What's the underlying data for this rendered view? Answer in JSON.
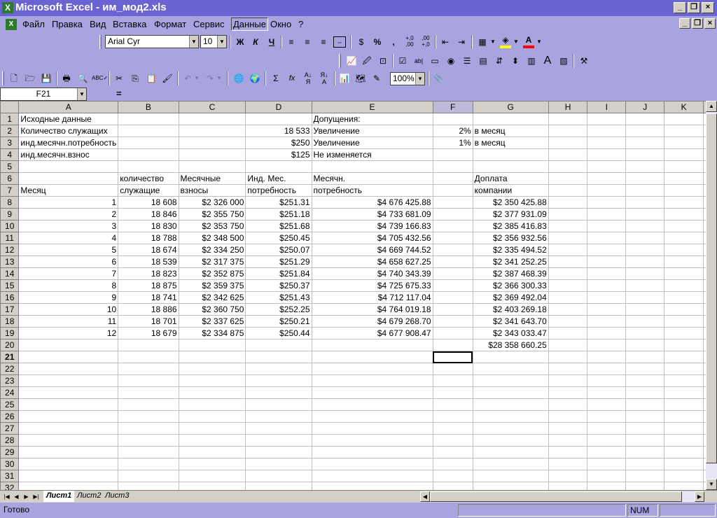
{
  "window": {
    "title": "Microsoft Excel - им_мод2.xls",
    "logo": "X"
  },
  "menu": [
    "Файл",
    "Правка",
    "Вид",
    "Вставка",
    "Формат",
    "Сервис",
    "Данные",
    "Окно",
    "?"
  ],
  "menu_active": "Данные",
  "format_toolbar": {
    "font_name": "Arial Cyr",
    "font_size": "10",
    "bold": "Ж",
    "italic": "К",
    "underline": "Ч",
    "percent": "%",
    "comma": ",",
    "inc_decimal": "+,0\n,00",
    "dec_decimal": ",00\n+,0"
  },
  "standard_toolbar": {
    "zoom": "100%",
    "sum": "Σ",
    "fx": "fx"
  },
  "formula_bar": {
    "name_box": "F21",
    "equals": "=",
    "content": ""
  },
  "columns": [
    "A",
    "B",
    "C",
    "D",
    "E",
    "F",
    "G",
    "H",
    "I",
    "J",
    "K"
  ],
  "selected_column": "F",
  "selected_row": "21",
  "rows": [
    {
      "n": "1",
      "cells": [
        "Исходные данные",
        "",
        "",
        "",
        "Допущения:",
        "",
        "",
        "",
        "",
        "",
        ""
      ]
    },
    {
      "n": "2",
      "cells": [
        "Количество служащих",
        "",
        "",
        "18 533",
        "Увеличение",
        "2%",
        " в месяц",
        "",
        "",
        "",
        ""
      ]
    },
    {
      "n": "3",
      "cells": [
        "инд.месячн.потребность",
        "",
        "",
        "$250",
        "Увеличение",
        "1%",
        "в месяц",
        "",
        "",
        "",
        ""
      ]
    },
    {
      "n": "4",
      "cells": [
        "инд.месячн.взнос",
        "",
        "",
        "$125",
        "Не изменяется",
        "",
        "",
        "",
        "",
        "",
        ""
      ]
    },
    {
      "n": "5",
      "cells": [
        "",
        "",
        "",
        "",
        "",
        "",
        "",
        "",
        "",
        "",
        ""
      ]
    },
    {
      "n": "6",
      "cells": [
        "",
        "количество",
        "Месячные",
        "Инд. Мес.",
        "Месячн.",
        "",
        "Доплата",
        "",
        "",
        "",
        ""
      ]
    },
    {
      "n": "7",
      "cells": [
        "Месяц",
        "служащие",
        "взносы",
        "потребность",
        "потребность",
        "",
        "компании",
        "",
        "",
        "",
        ""
      ]
    },
    {
      "n": "8",
      "cells": [
        "1",
        "18 608",
        "$2 326 000",
        "$251.31",
        "$4 676 425.88",
        "",
        "$2 350 425.88",
        "",
        "",
        "",
        ""
      ]
    },
    {
      "n": "9",
      "cells": [
        "2",
        "18 846",
        "$2 355 750",
        "$251.18",
        "$4 733 681.09",
        "",
        "$2 377 931.09",
        "",
        "",
        "",
        ""
      ]
    },
    {
      "n": "10",
      "cells": [
        "3",
        "18 830",
        "$2 353 750",
        "$251.68",
        "$4 739 166.83",
        "",
        "$2 385 416.83",
        "",
        "",
        "",
        ""
      ]
    },
    {
      "n": "11",
      "cells": [
        "4",
        "18 788",
        "$2 348 500",
        "$250.45",
        "$4 705 432.56",
        "",
        "$2 356 932.56",
        "",
        "",
        "",
        ""
      ]
    },
    {
      "n": "12",
      "cells": [
        "5",
        "18 674",
        "$2 334 250",
        "$250.07",
        "$4 669 744.52",
        "",
        "$2 335 494.52",
        "",
        "",
        "",
        ""
      ]
    },
    {
      "n": "13",
      "cells": [
        "6",
        "18 539",
        "$2 317 375",
        "$251.29",
        "$4 658 627.25",
        "",
        "$2 341 252.25",
        "",
        "",
        "",
        ""
      ]
    },
    {
      "n": "14",
      "cells": [
        "7",
        "18 823",
        "$2 352 875",
        "$251.84",
        "$4 740 343.39",
        "",
        "$2 387 468.39",
        "",
        "",
        "",
        ""
      ]
    },
    {
      "n": "15",
      "cells": [
        "8",
        "18 875",
        "$2 359 375",
        "$250.37",
        "$4 725 675.33",
        "",
        "$2 366 300.33",
        "",
        "",
        "",
        ""
      ]
    },
    {
      "n": "16",
      "cells": [
        "9",
        "18 741",
        "$2 342 625",
        "$251.43",
        "$4 712 117.04",
        "",
        "$2 369 492.04",
        "",
        "",
        "",
        ""
      ]
    },
    {
      "n": "17",
      "cells": [
        "10",
        "18 886",
        "$2 360 750",
        "$252.25",
        "$4 764 019.18",
        "",
        "$2 403 269.18",
        "",
        "",
        "",
        ""
      ]
    },
    {
      "n": "18",
      "cells": [
        "11",
        "18 701",
        "$2 337 625",
        "$250.21",
        "$4 679 268.70",
        "",
        "$2 341 643.70",
        "",
        "",
        "",
        ""
      ]
    },
    {
      "n": "19",
      "cells": [
        "12",
        "18 679",
        "$2 334 875",
        "$250.44",
        "$4 677 908.47",
        "",
        "$2 343 033.47",
        "",
        "",
        "",
        ""
      ]
    },
    {
      "n": "20",
      "cells": [
        "",
        "",
        "",
        "",
        "",
        "",
        "$28 358 660.25",
        "",
        "",
        "",
        ""
      ]
    },
    {
      "n": "21",
      "cells": [
        "",
        "",
        "",
        "",
        "",
        "",
        "",
        "",
        "",
        "",
        ""
      ]
    },
    {
      "n": "22",
      "cells": [
        "",
        "",
        "",
        "",
        "",
        "",
        "",
        "",
        "",
        "",
        ""
      ]
    },
    {
      "n": "23",
      "cells": [
        "",
        "",
        "",
        "",
        "",
        "",
        "",
        "",
        "",
        "",
        ""
      ]
    },
    {
      "n": "24",
      "cells": [
        "",
        "",
        "",
        "",
        "",
        "",
        "",
        "",
        "",
        "",
        ""
      ]
    },
    {
      "n": "25",
      "cells": [
        "",
        "",
        "",
        "",
        "",
        "",
        "",
        "",
        "",
        "",
        ""
      ]
    },
    {
      "n": "26",
      "cells": [
        "",
        "",
        "",
        "",
        "",
        "",
        "",
        "",
        "",
        "",
        ""
      ]
    },
    {
      "n": "27",
      "cells": [
        "",
        "",
        "",
        "",
        "",
        "",
        "",
        "",
        "",
        "",
        ""
      ]
    },
    {
      "n": "28",
      "cells": [
        "",
        "",
        "",
        "",
        "",
        "",
        "",
        "",
        "",
        "",
        ""
      ]
    },
    {
      "n": "29",
      "cells": [
        "",
        "",
        "",
        "",
        "",
        "",
        "",
        "",
        "",
        "",
        ""
      ]
    },
    {
      "n": "30",
      "cells": [
        "",
        "",
        "",
        "",
        "",
        "",
        "",
        "",
        "",
        "",
        ""
      ]
    },
    {
      "n": "31",
      "cells": [
        "",
        "",
        "",
        "",
        "",
        "",
        "",
        "",
        "",
        "",
        ""
      ]
    },
    {
      "n": "32",
      "cells": [
        "",
        "",
        "",
        "",
        "",
        "",
        "",
        "",
        "",
        "",
        ""
      ]
    }
  ],
  "sheet_tabs": [
    "Лист1",
    "Лист2",
    "Лист3"
  ],
  "active_sheet": "Лист1",
  "status": {
    "ready": "Готово",
    "num": "NUM"
  },
  "colors": {
    "title_bar": "#6a64d2",
    "chrome": "#a9a4e0",
    "selection": "#000000"
  }
}
